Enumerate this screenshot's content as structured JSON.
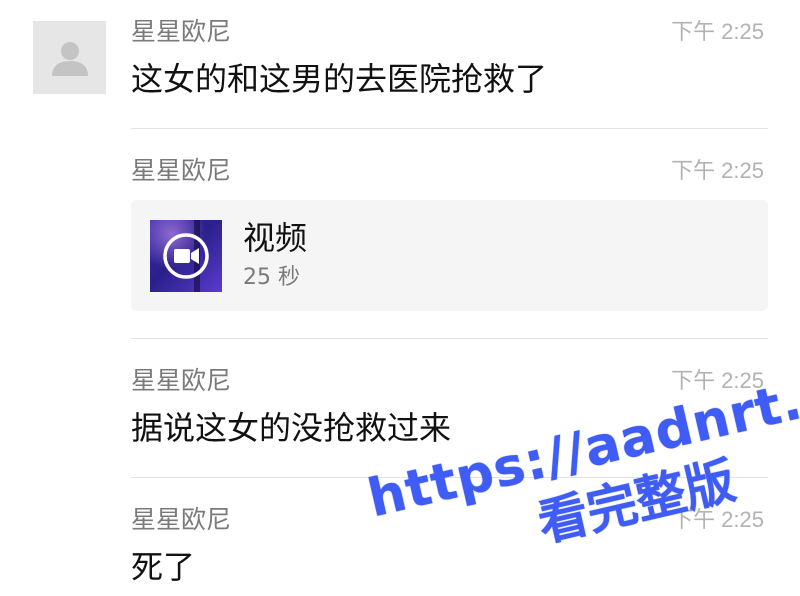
{
  "messages": [
    {
      "sender": "星星欧尼",
      "time": "下午 2:25",
      "text": "这女的和这男的去医院抢救了"
    },
    {
      "sender": "星星欧尼",
      "time": "下午 2:25",
      "video": {
        "title": "视频",
        "duration": "25 秒"
      }
    },
    {
      "sender": "星星欧尼",
      "time": "下午 2:25",
      "text": "据说这女的没抢救过来"
    },
    {
      "sender": "星星欧尼",
      "time": "下午 2:25",
      "text": "死了"
    }
  ],
  "watermark": {
    "url": "https://aadnrt.com",
    "subtitle": "看完整版"
  },
  "icons": {
    "avatar": "default-user-icon",
    "video": "video-camera-icon"
  },
  "colors": {
    "watermark": "#3f5cf4",
    "sender": "#7a7a7a",
    "time": "#b2b2b2",
    "card_background": "#f5f5f5"
  }
}
